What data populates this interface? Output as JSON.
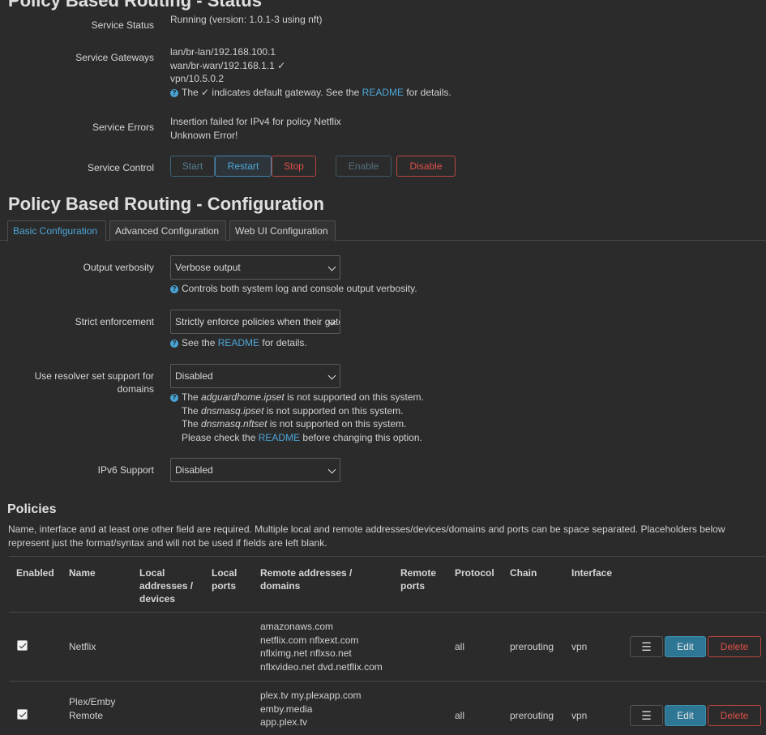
{
  "status": {
    "title": "Policy Based Routing - Status",
    "service_status_label": "Service Status",
    "service_status_value": "Running (version: 1.0.1-3 using nft)",
    "gateways_label": "Service Gateways",
    "gateways": [
      "lan/br-lan/192.168.100.1",
      "wan/br-wan/192.168.1.1 ✓",
      "vpn/10.5.0.2"
    ],
    "gateways_note_pre": "The ✓ indicates default gateway. See the",
    "gateways_note_link": "README",
    "gateways_note_post": "for details.",
    "errors_label": "Service Errors",
    "errors": [
      "Insertion failed for IPv4 for policy Netflix",
      "Unknown Error!"
    ],
    "control_label": "Service Control",
    "buttons": {
      "start": "Start",
      "restart": "Restart",
      "stop": "Stop",
      "enable": "Enable",
      "disable": "Disable"
    }
  },
  "config": {
    "title": "Policy Based Routing - Configuration",
    "tabs": [
      "Basic Configuration",
      "Advanced Configuration",
      "Web UI Configuration"
    ],
    "verbosity": {
      "label": "Output verbosity",
      "value": "Verbose output",
      "help": "Controls both system log and console output verbosity."
    },
    "strict": {
      "label": "Strict enforcement",
      "value": "Strictly enforce policies when their gateway is down",
      "help_pre": "See the",
      "help_link": "README",
      "help_post": "for details."
    },
    "resolver": {
      "label_line1": "Use resolver set support for",
      "label_line2": "domains",
      "value": "Disabled",
      "l1_pre": "The",
      "l1_em": "adguardhome.ipset",
      "l1_post": "is not supported on this system.",
      "l2_pre": "The",
      "l2_em": "dnsmasq.ipset",
      "l2_post": "is not supported on this system.",
      "l3_pre": "The",
      "l3_em": "dnsmasq.nftset",
      "l3_post": "is not supported on this system.",
      "l4_pre": "Please check the",
      "l4_link": "README",
      "l4_post": "before changing this option."
    },
    "ipv6": {
      "label": "IPv6 Support",
      "value": "Disabled"
    }
  },
  "policies": {
    "title": "Policies",
    "desc_line1": "Name, interface and at least one other field are required. Multiple local and remote addresses/devices/domains and ports can be space separated. Placeholders below",
    "desc_line2": "represent just the format/syntax and will not be used if fields are left blank.",
    "headers": {
      "enabled": "Enabled",
      "name": "Name",
      "local_addr_1": "Local",
      "local_addr_2": "addresses /",
      "local_addr_3": "devices",
      "local_ports_1": "Local",
      "local_ports_2": "ports",
      "remote_addr_1": "Remote addresses /",
      "remote_addr_2": "domains",
      "remote_ports_1": "Remote",
      "remote_ports_2": "ports",
      "protocol": "Protocol",
      "chain": "Chain",
      "interface": "Interface"
    },
    "rows": [
      {
        "name_1": "Netflix",
        "name_2": "",
        "remote": [
          "amazonaws.com",
          "netflix.com nflxext.com",
          "nflximg.net nflxso.net",
          "nflxvideo.net dvd.netflix.com"
        ],
        "protocol": "all",
        "chain": "prerouting",
        "interface": "vpn"
      },
      {
        "name_1": "Plex/Emby",
        "name_2": "Remote",
        "remote": [
          "plex.tv my.plexapp.com",
          "emby.media",
          "app.plex.tv"
        ],
        "protocol": "all",
        "chain": "prerouting",
        "interface": "vpn"
      }
    ],
    "row_buttons": {
      "menu": "☰",
      "edit": "Edit",
      "delete": "Delete"
    }
  }
}
